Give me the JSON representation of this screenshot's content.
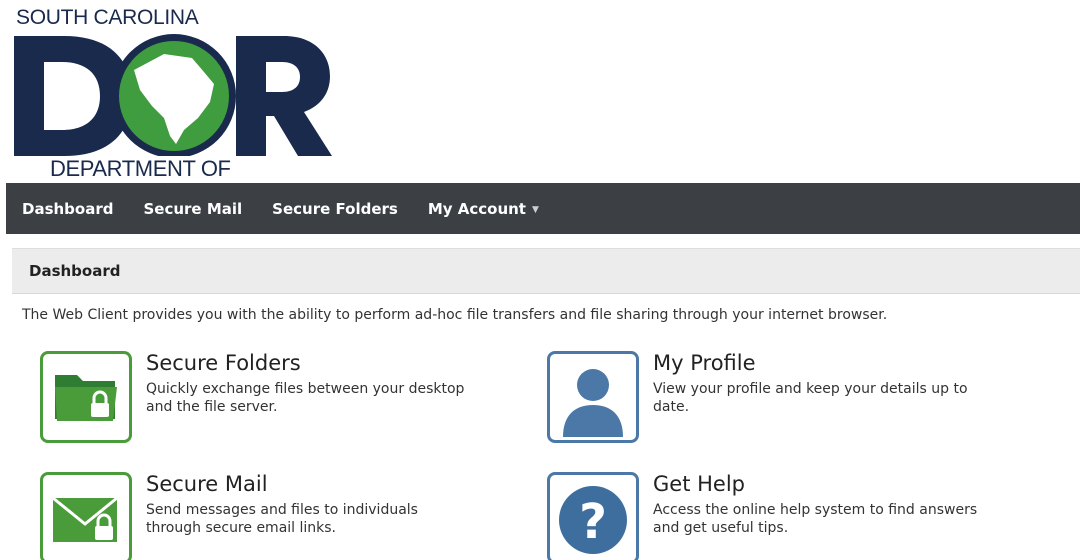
{
  "logo": {
    "top_text": "SOUTH CAROLINA",
    "bottom_text": "DEPARTMENT OF REVENUE",
    "letters": "DOR",
    "colors": {
      "navy": "#1a2a4d",
      "green": "#3f9c3f"
    }
  },
  "nav": {
    "items": [
      {
        "label": "Dashboard"
      },
      {
        "label": "Secure Mail"
      },
      {
        "label": "Secure Folders"
      },
      {
        "label": "My Account",
        "dropdown": true
      }
    ]
  },
  "section": {
    "title": "Dashboard"
  },
  "intro": "The Web Client provides you with the ability to perform ad-hoc file transfers and file sharing through your internet browser.",
  "tiles": [
    {
      "title": "Secure Folders",
      "description": "Quickly exchange files between your desktop and the file server.",
      "icon": "folder-lock-icon",
      "color": "#4a9c3a"
    },
    {
      "title": "My Profile",
      "description": "View your profile and keep your details up to date.",
      "icon": "user-icon",
      "color": "#4c78a8"
    },
    {
      "title": "Secure Mail",
      "description": "Send messages and files to individuals through secure email links.",
      "icon": "envelope-lock-icon",
      "color": "#4a9c3a"
    },
    {
      "title": "Get Help",
      "description": "Access the online help system to find answers and get useful tips.",
      "icon": "help-icon",
      "color": "#4c78a8"
    }
  ]
}
